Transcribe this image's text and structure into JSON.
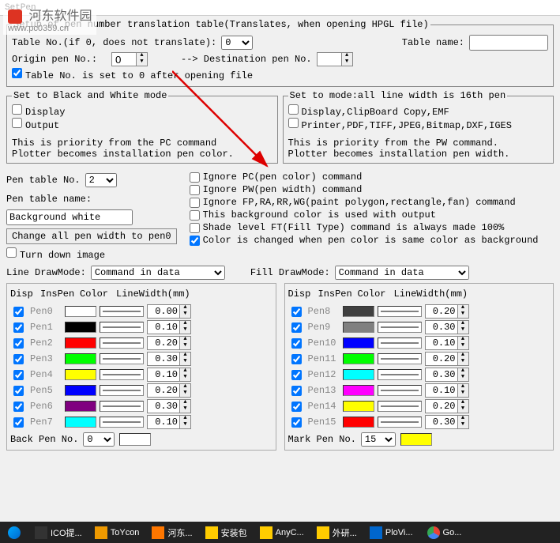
{
  "window": {
    "title": "SetPen"
  },
  "watermark": {
    "text": "河东软件园",
    "url": "www.pc0359.cn"
  },
  "top_group": {
    "legend": "Setup of pen number translation table(Translates, when opening HPGL file)",
    "table_no_label": "Table No.(if 0, does not translate):",
    "table_no_value": "0",
    "table_name_label": "Table name:",
    "table_name_value": "",
    "origin_label": "Origin pen No.:",
    "origin_value": "0",
    "arrow_label": "-->  Destination pen No.",
    "dest_value": "",
    "reset_check": "Table No. is set to 0 after opening file"
  },
  "bw_group": {
    "legend": "Set to Black and White mode",
    "display": "Display",
    "output": "Output",
    "note1": "This is priority from the PC command",
    "note2": "Plotter becomes installation pen color."
  },
  "mode_group": {
    "legend": "Set to mode:all line width is 16th pen",
    "opt1": "Display,ClipBoard Copy,EMF",
    "opt2": "Printer,PDF,TIFF,JPEG,Bitmap,DXF,IGES",
    "note1": "This is priority from the PW command.",
    "note2": "Plotter becomes installation pen width."
  },
  "mid": {
    "pen_table_no_label": "Pen table No.",
    "pen_table_no_value": "2",
    "pen_table_name_label": "Pen table name:",
    "pen_table_name_value": "Background white",
    "change_btn": "Change all pen width to pen0",
    "turn_down": "Turn down image",
    "c1": "Ignore PC(pen color) command",
    "c2": "Ignore PW(pen width) command",
    "c3": "Ignore FP,RA,RR,WG(paint polygon,rectangle,fan) command",
    "c4": "This background color is used with output",
    "c5": "Shade level FT(Fill Type) command is always made 100%",
    "c6": "Color is changed when pen color is same color as background"
  },
  "drawmode": {
    "line_label": "Line DrawMode:",
    "line_value": "Command in data",
    "fill_label": "Fill DrawMode:",
    "fill_value": "Command in data",
    "hdr_disp": "Disp",
    "hdr_ins": "InsPen",
    "hdr_color": "Color",
    "hdr_lw": "LineWidth(mm)"
  },
  "pens_left": [
    {
      "name": "Pen0",
      "color": "#ffffff",
      "width": "0.00"
    },
    {
      "name": "Pen1",
      "color": "#000000",
      "width": "0.10"
    },
    {
      "name": "Pen2",
      "color": "#ff0000",
      "width": "0.20"
    },
    {
      "name": "Pen3",
      "color": "#00ff00",
      "width": "0.30"
    },
    {
      "name": "Pen4",
      "color": "#ffff00",
      "width": "0.10"
    },
    {
      "name": "Pen5",
      "color": "#0000ff",
      "width": "0.20"
    },
    {
      "name": "Pen6",
      "color": "#800080",
      "width": "0.30"
    },
    {
      "name": "Pen7",
      "color": "#00ffff",
      "width": "0.10"
    }
  ],
  "pens_right": [
    {
      "name": "Pen8",
      "color": "#404040",
      "width": "0.20"
    },
    {
      "name": "Pen9",
      "color": "#808080",
      "width": "0.30"
    },
    {
      "name": "Pen10",
      "color": "#0000ff",
      "width": "0.10"
    },
    {
      "name": "Pen11",
      "color": "#00ff00",
      "width": "0.20"
    },
    {
      "name": "Pen12",
      "color": "#00ffff",
      "width": "0.30"
    },
    {
      "name": "Pen13",
      "color": "#ff00ff",
      "width": "0.10"
    },
    {
      "name": "Pen14",
      "color": "#ffff00",
      "width": "0.20"
    },
    {
      "name": "Pen15",
      "color": "#ff0000",
      "width": "0.30"
    }
  ],
  "bottom": {
    "back_pen_label": "Back Pen No.",
    "back_pen_value": "0",
    "back_pen_color": "#ffffff",
    "mark_pen_label": "Mark Pen No.",
    "mark_pen_value": "15",
    "mark_pen_color": "#ffff00"
  },
  "taskbar": {
    "items": [
      "ICO提...",
      "ToYcon",
      "河东...",
      "安装包",
      "AnyC...",
      "外研...",
      "PloVi...",
      "Go..."
    ]
  }
}
